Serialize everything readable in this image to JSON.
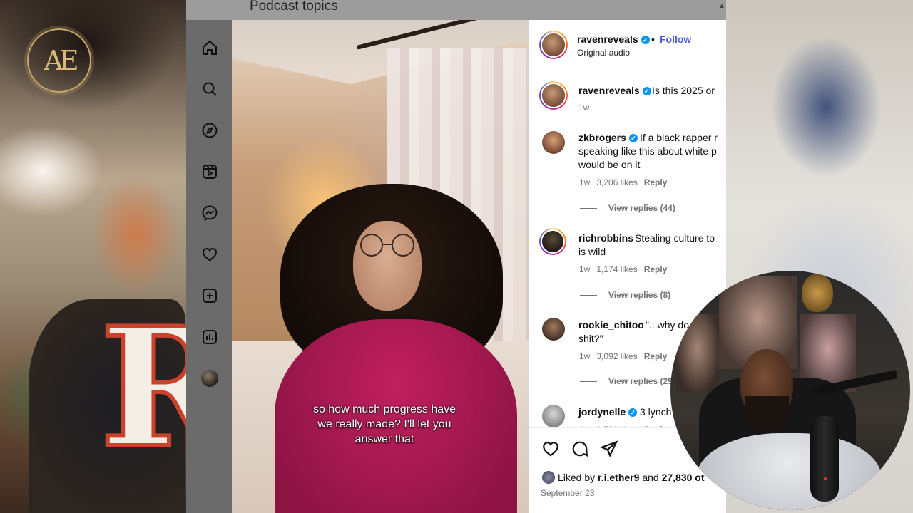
{
  "window": {
    "title": "Podcast topics"
  },
  "overlay": {
    "logo_text": "AE"
  },
  "nav": {
    "items": [
      {
        "name": "home-icon"
      },
      {
        "name": "search-icon"
      },
      {
        "name": "explore-icon"
      },
      {
        "name": "reels-icon"
      },
      {
        "name": "messenger-icon"
      },
      {
        "name": "heart-icon"
      },
      {
        "name": "create-icon"
      },
      {
        "name": "insights-icon"
      },
      {
        "name": "profile-avatar"
      }
    ]
  },
  "video": {
    "caption_line1": "so how much progress have",
    "caption_line2": "we really made? I'll let you",
    "caption_line3": "answer that"
  },
  "post": {
    "author": "ravenreveals",
    "dot": "•",
    "follow_label": "Follow",
    "audio": "Original audio",
    "caption_author": "ravenreveals",
    "caption_text": "Is this 2025 or",
    "caption_age": "1w"
  },
  "comments": [
    {
      "user": "zkbrogers",
      "verified": true,
      "line1": "If a black rapper r",
      "line2": "speaking like this about white p",
      "line3": "would be on it",
      "age": "1w",
      "likes": "3,206 likes",
      "reply": "Reply",
      "view_replies": "View replies (44)"
    },
    {
      "user": "richrobbins",
      "verified": false,
      "line1": "Stealing culture to",
      "line2": "is wild",
      "line3": "",
      "age": "1w",
      "likes": "1,174 likes",
      "reply": "Reply",
      "view_replies": "View replies (8)"
    },
    {
      "user": "rookie_chitoo",
      "verified": false,
      "line1": "\"...why do",
      "line2": "shit?\"",
      "line3": "",
      "age": "1w",
      "likes": "3,092 likes",
      "reply": "Reply",
      "view_replies": "View replies (29"
    },
    {
      "user": "jordynelle",
      "verified": true,
      "line1": "3 lynch",
      "line2": "",
      "line3": "",
      "age": "1w",
      "likes": "1,789 likes",
      "reply": "Reply",
      "view_replies": ""
    }
  ],
  "actions": {
    "liked_prefix": "Liked by",
    "liked_user": "r.i.ether9",
    "liked_and": "and",
    "liked_count": "27,830 ot",
    "date": "September 23"
  },
  "colors": {
    "accent": "#4f5bd5",
    "verified": "#0095f6",
    "nav_bg": "#6b6b6b"
  }
}
